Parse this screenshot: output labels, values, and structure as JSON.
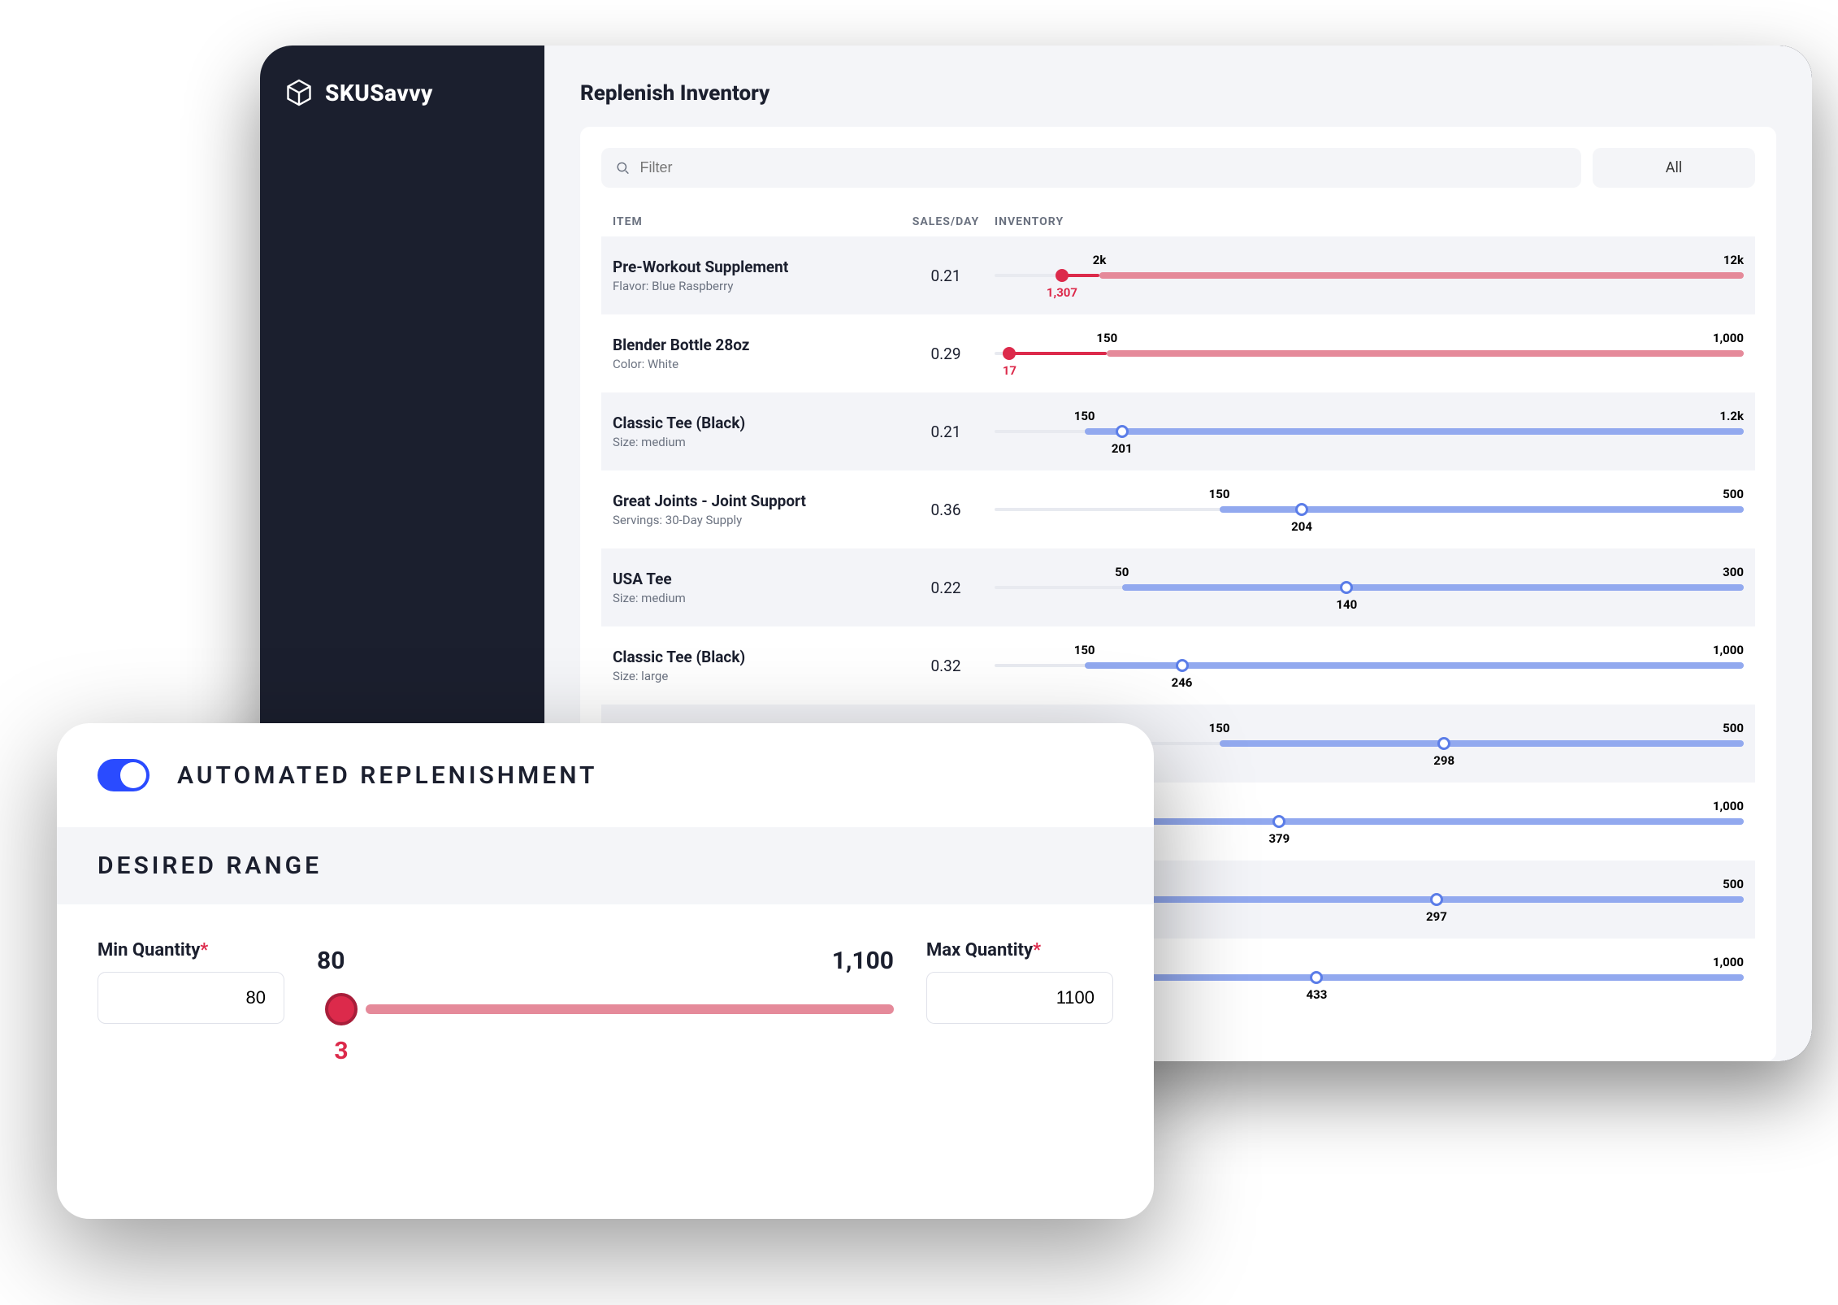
{
  "brand": "SKUSavvy",
  "page": {
    "title": "Replenish Inventory"
  },
  "toolbar": {
    "filter_placeholder": "Filter",
    "all_label": "All"
  },
  "columns": {
    "item": "ITEM",
    "sales": "SALES/DAY",
    "inventory": "INVENTORY"
  },
  "rows": [
    {
      "name": "Pre-Workout Supplement",
      "sub": "Flavor: Blue Raspberry",
      "sales": "0.21",
      "min": "2k",
      "max": "12k",
      "current": "1,307",
      "state": "below",
      "min_pct": 14,
      "cur_pct": 9
    },
    {
      "name": "Blender Bottle 28oz",
      "sub": "Color: White",
      "sales": "0.29",
      "min": "150",
      "max": "1,000",
      "current": "17",
      "state": "below",
      "min_pct": 15,
      "cur_pct": 2
    },
    {
      "name": "Classic Tee (Black)",
      "sub": "Size: medium",
      "sales": "0.21",
      "min": "150",
      "max": "1.2k",
      "current": "201",
      "state": "ok",
      "min_pct": 12,
      "cur_pct": 17
    },
    {
      "name": "Great Joints - Joint Support",
      "sub": "Servings: 30-Day Supply",
      "sales": "0.36",
      "min": "150",
      "max": "500",
      "current": "204",
      "state": "ok",
      "min_pct": 30,
      "cur_pct": 41
    },
    {
      "name": "USA Tee",
      "sub": "Size: medium",
      "sales": "0.22",
      "min": "50",
      "max": "300",
      "current": "140",
      "state": "ok",
      "min_pct": 17,
      "cur_pct": 47
    },
    {
      "name": "Classic Tee (Black)",
      "sub": "Size: large",
      "sales": "0.32",
      "min": "150",
      "max": "1,000",
      "current": "246",
      "state": "ok",
      "min_pct": 12,
      "cur_pct": 25
    },
    {
      "name": "",
      "sub": "",
      "sales": "",
      "min": "150",
      "max": "500",
      "current": "298",
      "state": "ok",
      "min_pct": 30,
      "cur_pct": 60
    },
    {
      "name": "",
      "sub": "",
      "sales": "",
      "min": "",
      "max": "1,000",
      "current": "379",
      "state": "ok",
      "min_pct": 0,
      "cur_pct": 38
    },
    {
      "name": "",
      "sub": "",
      "sales": "",
      "min": "",
      "max": "500",
      "current": "297",
      "state": "ok",
      "min_pct": 0,
      "cur_pct": 59
    },
    {
      "name": "",
      "sub": "",
      "sales": "",
      "min": "",
      "max": "1,000",
      "current": "433",
      "state": "ok",
      "min_pct": 0,
      "cur_pct": 43
    }
  ],
  "card": {
    "auto_label": "AUTOMATED REPLENISHMENT",
    "range_label": "DESIRED RANGE",
    "min_label": "Min Quantity",
    "max_label": "Max Quantity",
    "min_value": "80",
    "max_value": "1100",
    "slider_low": "80",
    "slider_high": "1,100",
    "slider_handle": "3"
  }
}
